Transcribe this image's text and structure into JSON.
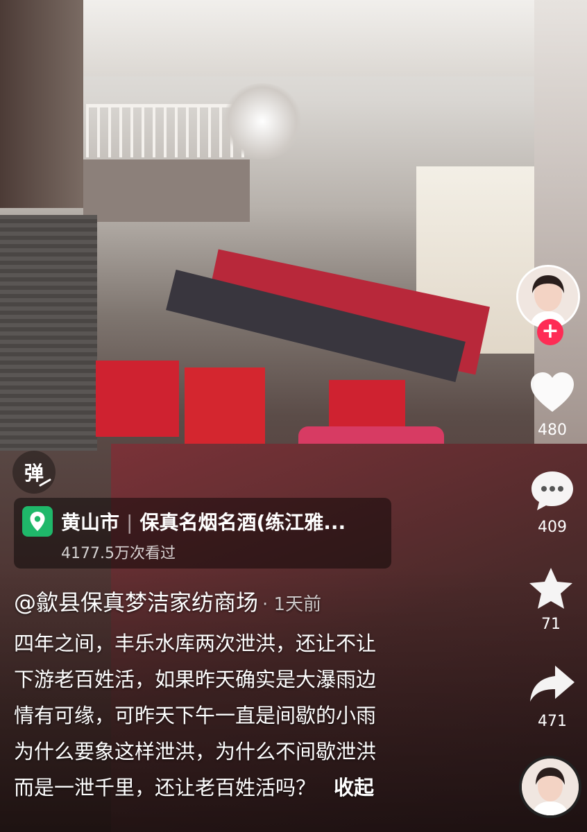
{
  "overlay": {
    "danmu_label": "弹"
  },
  "location": {
    "city": "黄山市",
    "place": "保真名烟名酒(练江雅...",
    "views": "4177.5万次看过"
  },
  "post": {
    "author": "@歙县保真梦洁家纺商场",
    "time": "· 1天前",
    "description_lines": [
      "四年之间，丰乐水库两次泄洪，还让不让",
      "下游老百姓活，如果昨天确实是大瀑雨边",
      "情有可缘，可昨天下午一直是间歇的小雨",
      "为什么要象这样泄洪，为什么不间歇泄洪",
      "而是一泄千里，还让老百姓活吗？"
    ],
    "collapse_label": "收起"
  },
  "actions": {
    "follow_symbol": "+",
    "likes": "480",
    "comments": "409",
    "favorites": "71",
    "shares": "471"
  },
  "colors": {
    "accent_red": "#fe2c55",
    "location_green": "#1fb86a"
  },
  "icons": [
    "danmu-icon",
    "location-pin-icon",
    "heart-icon",
    "comment-icon",
    "star-icon",
    "share-icon"
  ]
}
